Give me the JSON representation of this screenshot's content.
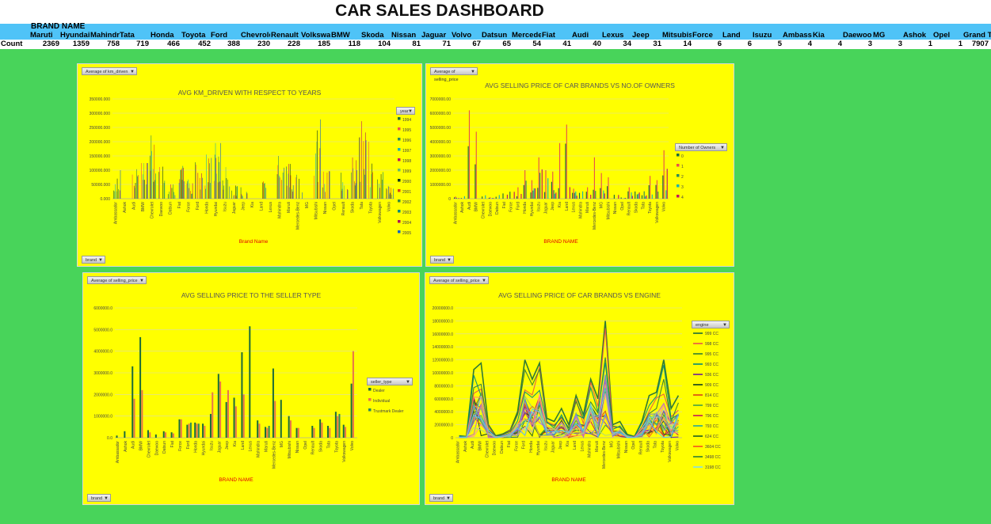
{
  "dashboard": {
    "title": "CAR SALES DASHBOARD"
  },
  "pivot": {
    "field_label": "BRAND NAME",
    "row_label": "Count",
    "headers": [
      "Maruti",
      "Hyundai",
      "Mahindra",
      "Tata",
      "Honda",
      "Toyota",
      "Ford",
      "Chevrolet",
      "Renault",
      "Volkswagen",
      "BMW",
      "Skoda",
      "Nissan",
      "Jaguar",
      "Volvo",
      "Datsun",
      "Mercedes-Benz",
      "Fiat",
      "Audi",
      "Lexus",
      "Jeep",
      "Mitsubishi",
      "Force",
      "Land",
      "Isuzu",
      "Ambassador",
      "Kia",
      "",
      "Daewoo",
      "MG",
      "",
      "Ashok",
      "Opel",
      "Grand Total"
    ],
    "counts": [
      "2369",
      "1359",
      "758",
      "719",
      "466",
      "452",
      "388",
      "230",
      "228",
      "185",
      "118",
      "104",
      "81",
      "71",
      "67",
      "65",
      "54",
      "41",
      "40",
      "34",
      "31",
      "14",
      "6",
      "6",
      "5",
      "4",
      "4",
      "3",
      "",
      "3",
      "",
      "1",
      "1",
      "7907"
    ]
  },
  "chart_data": [
    {
      "type": "bar",
      "title": "AVG KM_DRIVEN WITH RESPECT TO YEARS",
      "field_button": "Average of km_driven",
      "axis_button": "brand",
      "xlabel": "Brand Name",
      "ylabel": "",
      "ylim": [
        0,
        350000
      ],
      "yticks": [
        "0.000",
        "50000.000",
        "100000.000",
        "150000.000",
        "200000.000",
        "250000.000",
        "300000.000",
        "350000.000"
      ],
      "legend_title": "year",
      "legend_position": "right",
      "categories": [
        "Ambassador",
        "Ashok",
        "Audi",
        "BMW",
        "Chevrolet",
        "Daewoo",
        "Datsun",
        "Fiat",
        "Force",
        "Ford",
        "Honda",
        "Hyundai",
        "Isuzu",
        "Jaguar",
        "Jeep",
        "Kia",
        "Land",
        "Lexus",
        "Mahindra",
        "Maruti",
        "Mercedes-Benz",
        "MG",
        "Mitsubishi",
        "Nissan",
        "Opel",
        "Renault",
        "Skoda",
        "Tata",
        "Toyota",
        "Volkswagen",
        "Volvo"
      ],
      "series": [
        {
          "name": "1994",
          "color": "#1a6b3a"
        },
        {
          "name": "1995",
          "color": "#e8534a"
        },
        {
          "name": "1996",
          "color": "#2e8b57"
        },
        {
          "name": "1997",
          "color": "#20b2aa"
        },
        {
          "name": "1998",
          "color": "#c2185b"
        },
        {
          "name": "1999",
          "color": "#66bb6a"
        },
        {
          "name": "2000",
          "color": "#0d3b1e"
        },
        {
          "name": "2001",
          "color": "#d84315"
        },
        {
          "name": "2002",
          "color": "#388e3c"
        },
        {
          "name": "2003",
          "color": "#00897b"
        },
        {
          "name": "2004",
          "color": "#ad1457"
        },
        {
          "name": "2005",
          "color": "#1565c0"
        }
      ],
      "maxima": [
        100000,
        0,
        120000,
        125000,
        222000,
        135000,
        50000,
        115000,
        78000,
        145000,
        155000,
        195000,
        119000,
        50000,
        40000,
        0,
        70000,
        0,
        150000,
        122000,
        101000,
        0,
        278000,
        119000,
        0,
        120000,
        158000,
        290000,
        200000,
        105000,
        45000
      ]
    },
    {
      "type": "bar",
      "title": "AVG SELLING PRICE OF CAR BRANDS VS NO.OF OWNERS",
      "field_button": "Average of selling_price",
      "axis_button": "brand",
      "xlabel": "BRAND NAME",
      "ylabel": "",
      "ylim": [
        0,
        7000000
      ],
      "yticks": [
        "0",
        "1000000.00",
        "2000000.00",
        "3000000.00",
        "4000000.00",
        "5000000.00",
        "6000000.00",
        "7000000.00"
      ],
      "legend_title": "Number of Owners",
      "legend_position": "right",
      "categories": [
        "Ambassador",
        "Ashok",
        "Audi",
        "BMW",
        "Chevrolet",
        "Daewoo",
        "Datsun",
        "Fiat",
        "Force",
        "Ford",
        "Honda",
        "Hyundai",
        "Isuzu",
        "Jaguar",
        "Jeep",
        "Kia",
        "Land",
        "Lexus",
        "Mahindra",
        "Maruti",
        "Mercedes-Benz",
        "MG",
        "Mitsubishi",
        "Nissan",
        "Opel",
        "Renault",
        "Skoda",
        "Tata",
        "Toyota",
        "Volkswagen",
        "Volvo"
      ],
      "series": [
        {
          "name": "0",
          "color": "#1a6b3a"
        },
        {
          "name": "1",
          "color": "#e8534a"
        },
        {
          "name": "2",
          "color": "#2e8b57"
        },
        {
          "name": "3",
          "color": "#20b2aa"
        },
        {
          "name": "4",
          "color": "#c2185b"
        }
      ],
      "maxima": [
        150000,
        250000,
        6200000,
        4700000,
        350000,
        100000,
        350000,
        550000,
        900000,
        800000,
        2000000,
        1300000,
        2900000,
        2000000,
        1900000,
        3900000,
        5200000,
        700000,
        2000000,
        800000,
        2900000,
        1800000,
        1500000,
        700000,
        150000,
        800000,
        900000,
        800000,
        1600000,
        1300000,
        3400000
      ]
    },
    {
      "type": "bar",
      "title": "AVG SELLING PRICE TO THE SELLER TYPE",
      "field_button": "Average of selling_price",
      "axis_button": "brand",
      "xlabel": "BRAND NAME",
      "ylabel": "",
      "ylim": [
        0,
        6000000
      ],
      "yticks": [
        "0.0",
        "1000000.0",
        "2000000.0",
        "3000000.0",
        "4000000.0",
        "5000000.0",
        "6000000.0"
      ],
      "legend_title": "seller_type",
      "legend_position": "right",
      "categories": [
        "Ambassador",
        "Ashok",
        "Audi",
        "BMW",
        "Chevrolet",
        "Daewoo",
        "Datsun",
        "Fiat",
        "Force",
        "Ford",
        "Honda",
        "Hyundai",
        "Isuzu",
        "Jaguar",
        "Jeep",
        "Kia",
        "Land",
        "Lexus",
        "Mahindra",
        "Maruti",
        "Mercedes-Benz",
        "MG",
        "Mitsubishi",
        "Nissan",
        "Opel",
        "Renault",
        "Skoda",
        "Tata",
        "Toyota",
        "Volkswagen",
        "Volvo"
      ],
      "series": [
        {
          "name": "Dealer",
          "color": "#1a6b3a",
          "values": [
            100000,
            300000,
            3300000,
            4650000,
            350000,
            150000,
            300000,
            250000,
            850000,
            600000,
            700000,
            650000,
            1100000,
            2950000,
            1650000,
            1850000,
            3950000,
            5150000,
            800000,
            500000,
            3200000,
            1750000,
            1000000,
            450000,
            0,
            550000,
            850000,
            550000,
            1200000,
            600000,
            2500000
          ]
        },
        {
          "name": "Individual",
          "color": "#e8734a",
          "values": [
            0,
            0,
            1800000,
            2200000,
            250000,
            0,
            250000,
            200000,
            850000,
            650000,
            650000,
            550000,
            2100000,
            2600000,
            2200000,
            1450000,
            2000000,
            0,
            650000,
            450000,
            1700000,
            0,
            800000,
            450000,
            0,
            450000,
            700000,
            450000,
            1000000,
            500000,
            4000000
          ]
        },
        {
          "name": "Trustmark Dealer",
          "color": "#2e8b57",
          "values": [
            0,
            0,
            0,
            0,
            0,
            0,
            0,
            0,
            0,
            700000,
            650000,
            0,
            0,
            0,
            0,
            0,
            0,
            0,
            0,
            550000,
            0,
            0,
            0,
            0,
            0,
            0,
            0,
            0,
            1100000,
            0,
            0
          ]
        }
      ]
    },
    {
      "type": "line",
      "title": "AVG SELLING PRICE OF CAR BRANDS VS ENGINE",
      "field_button": "Average of selling_price",
      "axis_button": "brand",
      "xlabel": "BRAND NAME",
      "ylabel": "",
      "ylim": [
        0,
        20000000
      ],
      "yticks": [
        "0",
        "2000000.0",
        "4000000.0",
        "6000000.0",
        "8000000.0",
        "10000000.0",
        "12000000.0",
        "14000000.0",
        "16000000.0",
        "18000000.0",
        "20000000.0"
      ],
      "legend_title": "engine",
      "legend_position": "right",
      "categories": [
        "Ambassador",
        "Ashok",
        "Audi",
        "BMW",
        "Chevrolet",
        "Daewoo",
        "Datsun",
        "Fiat",
        "Force",
        "Ford",
        "Honda",
        "Hyundai",
        "Isuzu",
        "Jaguar",
        "Jeep",
        "Kia",
        "Land",
        "Lexus",
        "Mahindra",
        "Maruti",
        "Mercedes-Benz",
        "MG",
        "Mitsubishi",
        "Nissan",
        "Opel",
        "Renault",
        "Skoda",
        "Tata",
        "Toyota",
        "Volkswagen",
        "Volvo"
      ],
      "legend_entries": [
        {
          "name": "999 CC",
          "color": "#1a6b3a"
        },
        {
          "name": "998 CC",
          "color": "#e8534a"
        },
        {
          "name": "995 CC",
          "color": "#2e7d32"
        },
        {
          "name": "993 CC",
          "color": "#00897b"
        },
        {
          "name": "936 CC",
          "color": "#6a1b9a"
        },
        {
          "name": "909 CC",
          "color": "#0d3b1e"
        },
        {
          "name": "814 CC",
          "color": "#d84315"
        },
        {
          "name": "799 CC",
          "color": "#43a047"
        },
        {
          "name": "796 CC",
          "color": "#c2185b"
        },
        {
          "name": "793 CC",
          "color": "#26a69a"
        },
        {
          "name": "624 CC",
          "color": "#1b5e20"
        },
        {
          "name": "3604 CC",
          "color": "#f4511e"
        },
        {
          "name": "3498 CC",
          "color": "#2e7d32"
        },
        {
          "name": "3198 CC",
          "color": "#80deea"
        }
      ],
      "envelope": [
        300000,
        200000,
        10500000,
        11500000,
        2000000,
        300000,
        600000,
        1200000,
        4000000,
        12000000,
        9000000,
        11500000,
        3000000,
        2500000,
        4500000,
        2000000,
        6500000,
        3500000,
        9000000,
        6000000,
        18000000,
        2000000,
        2500000,
        500000,
        200000,
        2500000,
        6500000,
        7000000,
        12000000,
        4500000,
        6500000
      ]
    }
  ]
}
